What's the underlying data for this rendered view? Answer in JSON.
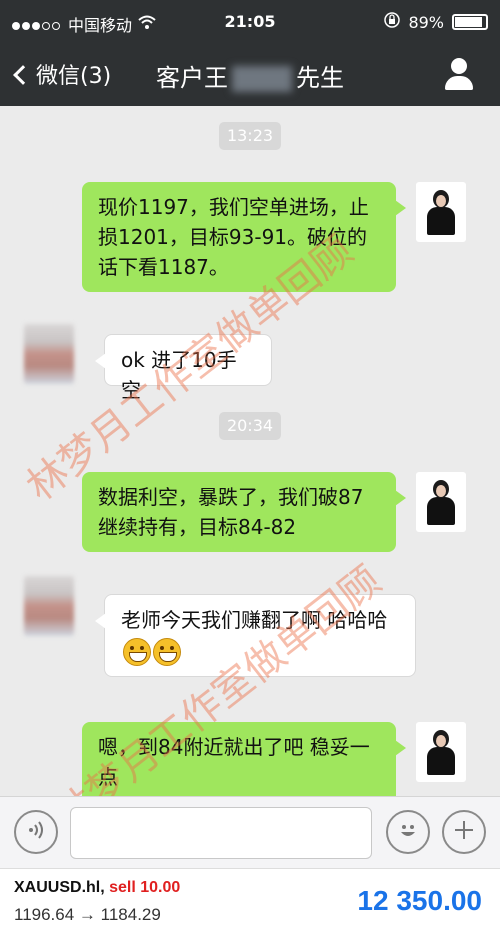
{
  "status": {
    "carrier": "中国移动",
    "time": "21:05",
    "battery": "89%",
    "battery_level": 0.89
  },
  "nav": {
    "back_label": "微信(3)",
    "title_prefix": "客户王",
    "title_suffix": "先生"
  },
  "messages": [
    {
      "type": "time",
      "text": "13:23"
    },
    {
      "type": "out",
      "text": "现价1197，我们空单进场，止损1201，目标93-91。破位的话下看1187。"
    },
    {
      "type": "in",
      "text": "ok 进了10手空"
    },
    {
      "type": "time",
      "text": "20:34"
    },
    {
      "type": "out",
      "text": "数据利空，暴跌了，我们破87继续持有，目标84-82"
    },
    {
      "type": "in",
      "text": "老师今天我们赚翻了啊 哈哈哈",
      "emoji": [
        "grin-emoji",
        "grin-emoji"
      ]
    },
    {
      "type": "out",
      "text": "嗯，到84附近就出了吧 稳妥一点"
    }
  ],
  "watermark": {
    "text": "林梦月工作室做单回顾",
    "color": "#ec6e46"
  },
  "input": {
    "voice_icon": "voice-icon",
    "emoji_icon": "emoji-icon",
    "plus_icon": "plus-icon"
  },
  "ticker": {
    "symbol": "XAUUSD.hl,",
    "action": "sell 10.00",
    "prices": "1196.64 → 1184.29",
    "amount": "12 350.00",
    "accent": "#1a73e8",
    "sell_color": "#e02020"
  }
}
